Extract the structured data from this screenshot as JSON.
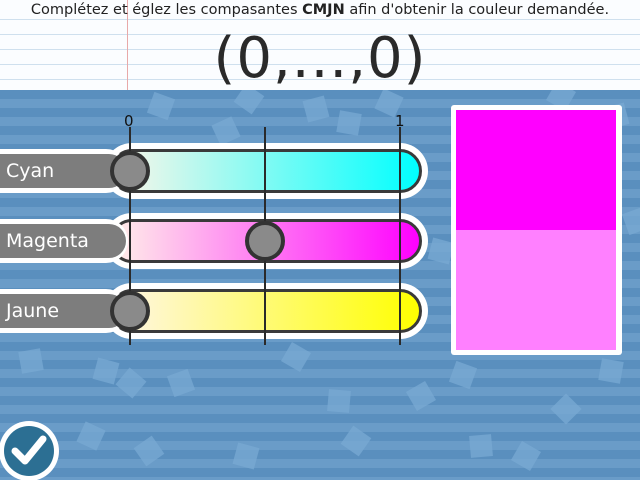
{
  "instruction": {
    "prefix": "Complétez et églez les compasantes ",
    "bold": "CMJN",
    "suffix": " afin d'obtenir la couleur demandée."
  },
  "formula": "(0,...,0)",
  "scale": {
    "min_label": "0",
    "max_label": "1"
  },
  "sliders": [
    {
      "label": "Cyan",
      "value": 0,
      "gradient_end": "#00ffff"
    },
    {
      "label": "Magenta",
      "value": 0.5,
      "gradient_end": "#ff00ff"
    },
    {
      "label": "Jaune",
      "value": 0,
      "gradient_end": "#ffff00"
    }
  ],
  "preview": {
    "target_color": "#ff00ff",
    "current_color": "#ff80ff"
  },
  "colors": {
    "board": "#5a8fbe",
    "knob": "#8a8a8a",
    "check": "#2c6f93"
  },
  "icons": {
    "validate": "check-icon"
  }
}
